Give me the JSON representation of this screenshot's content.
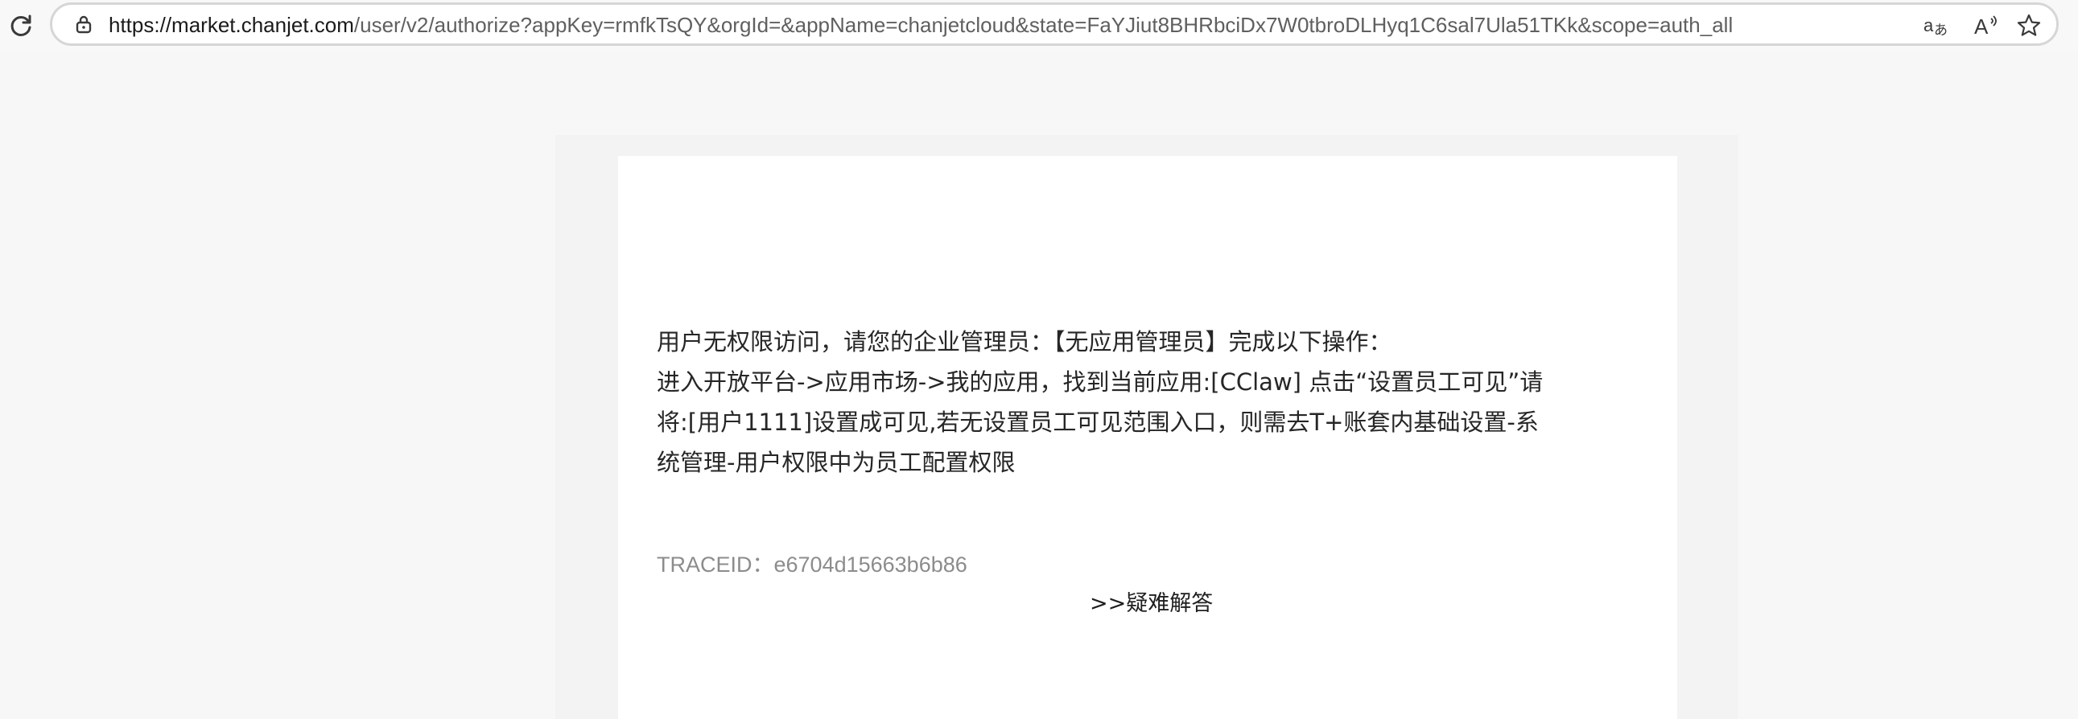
{
  "browser": {
    "url_domain": "https://market.chanjet.com",
    "url_rest": "/user/v2/authorize?appKey=rmfkTsQY&orgId=&appName=chanjetcloud&state=FaYJiut8BHRbciDx7W0tbroDLHyq1C6sal7Ula51TKk&scope=auth_all",
    "read_aloud_label": "A",
    "icons": [
      "reload-icon",
      "lock-icon",
      "translate-icon",
      "read-aloud-icon",
      "favorite-star-icon"
    ]
  },
  "main": {
    "message_lines": [
      "用户无权限访问，请您的企业管理员：【无应用管理员】完成以下操作：",
      "进入开放平台->应用市场->我的应用，找到当前应用:[CClaw] 点击“设置员工可见”请",
      "将:[用户1111]设置成可见,若无设置员工可见范围入口，则需去T+账套内基础设置-系",
      "统管理-用户权限中为员工配置权限"
    ],
    "trace_id": "TRACEID：e6704d15663b6b86",
    "faq_link": ">>疑难解答"
  }
}
